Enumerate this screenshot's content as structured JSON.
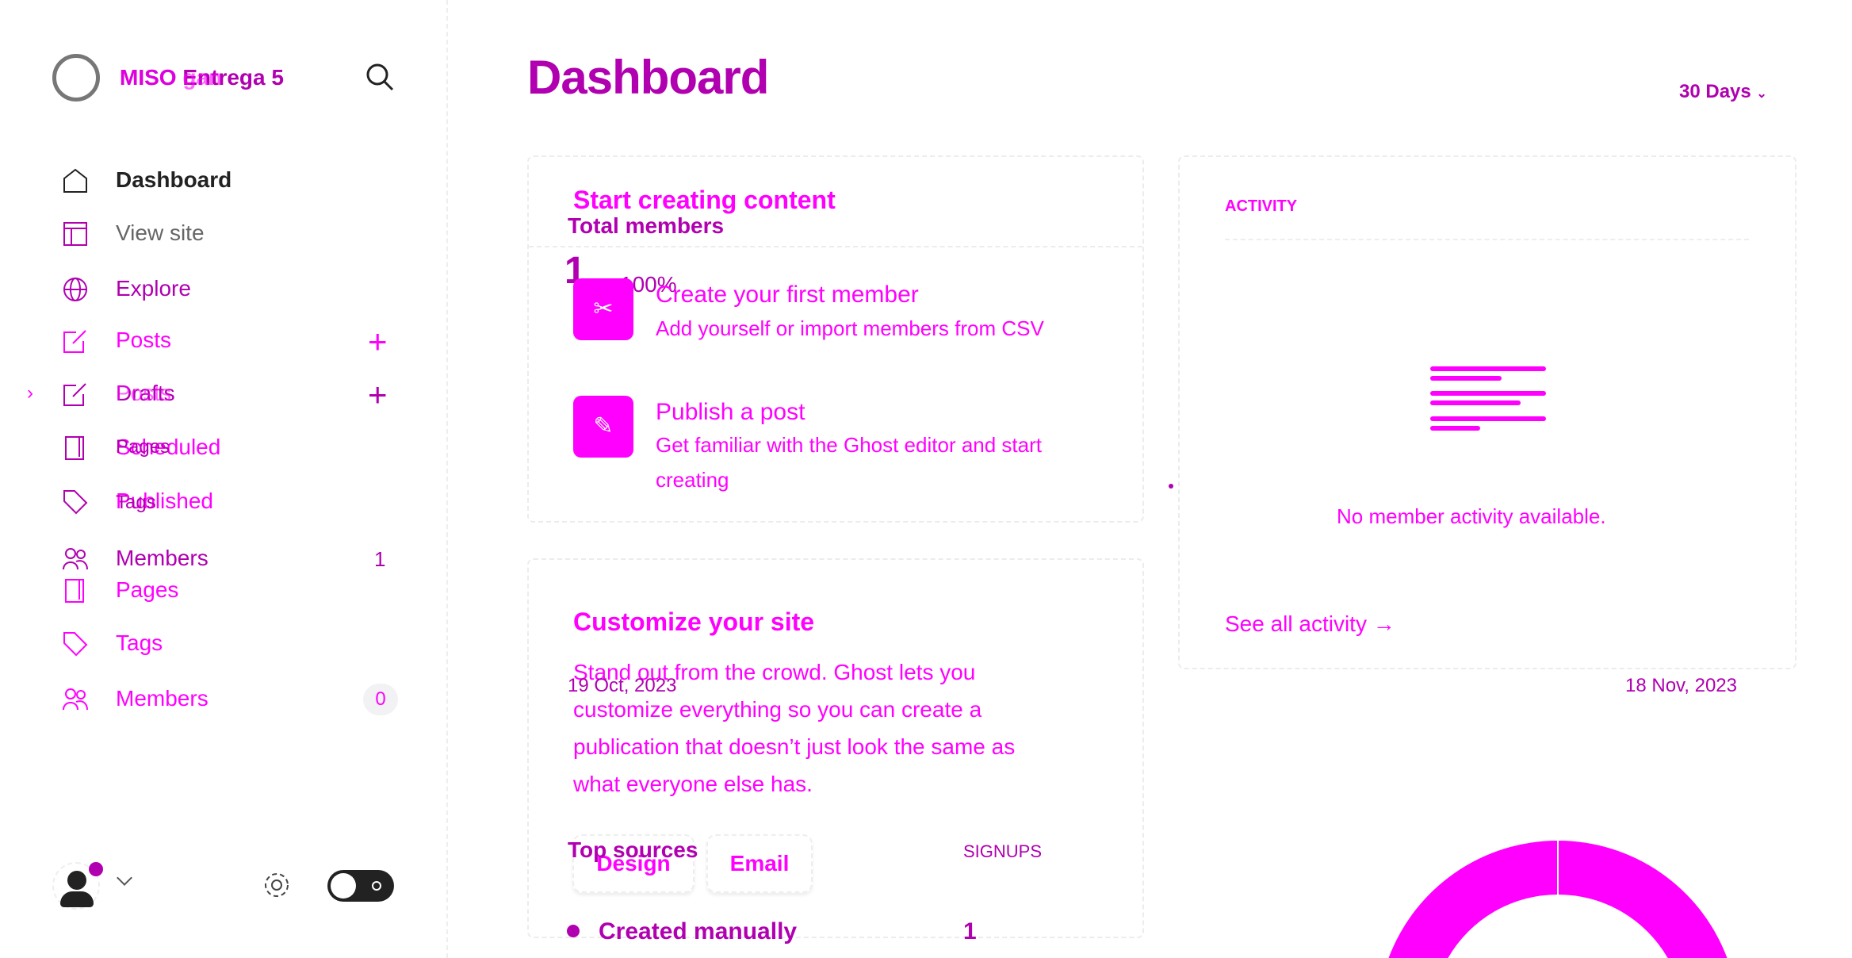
{
  "sidebar": {
    "site_title": "MISO Entrega 5",
    "site_title_ghost": "MISO gan",
    "items": [
      {
        "label": "Dashboard",
        "icon": "home-icon"
      },
      {
        "label": "View site",
        "icon": "layout-icon"
      },
      {
        "label": "Explore",
        "icon": "globe-icon"
      },
      {
        "label": "Posts",
        "icon": "edit-icon"
      },
      {
        "label": "Drafts",
        "ghost": "Posts",
        "icon": "edit-icon"
      },
      {
        "label": "Scheduled",
        "ghost": "Pages",
        "icon": "page-icon"
      },
      {
        "label": "Published",
        "ghost": "Tags",
        "icon": "tag-icon"
      },
      {
        "label": "Members",
        "count": "1",
        "icon": "members-icon"
      },
      {
        "label": "Pages",
        "icon": "page-icon"
      },
      {
        "label": "Tags",
        "icon": "tag-icon"
      },
      {
        "label": "Members",
        "count": "0",
        "icon": "members-icon"
      }
    ]
  },
  "header": {
    "title": "Dashboard",
    "range": "30 Days"
  },
  "start_card": {
    "title": "Start creating content",
    "total_members_label": "Total members",
    "total_members_value": "1",
    "total_members_pct": "100%",
    "steps": [
      {
        "title": "Create your first member",
        "desc": "Add yourself or import members from CSV"
      },
      {
        "title": "Publish a post",
        "desc1": "Get familiar with the Ghost editor and start",
        "desc2": "creating"
      }
    ]
  },
  "customize_card": {
    "title": "Customize your site",
    "lines": [
      "Stand out from the crowd. Ghost lets you",
      "customize everything so you can create a",
      "publication that doesn’t just look the same as",
      "what everyone else has."
    ],
    "date_start": "19 Oct, 2023",
    "buttons": [
      "Design",
      "Email"
    ],
    "top_sources_label": "Top sources",
    "signups_label": "SIGNUPS",
    "source": "Created manually",
    "source_value": "1"
  },
  "activity_card": {
    "title": "ACTIVITY",
    "empty": "No member activity available.",
    "see_all": "See all activity →",
    "date_end": "18 Nov, 2023"
  },
  "colors": {
    "accent": "#ff00ff",
    "secondary": "#b000b0"
  }
}
